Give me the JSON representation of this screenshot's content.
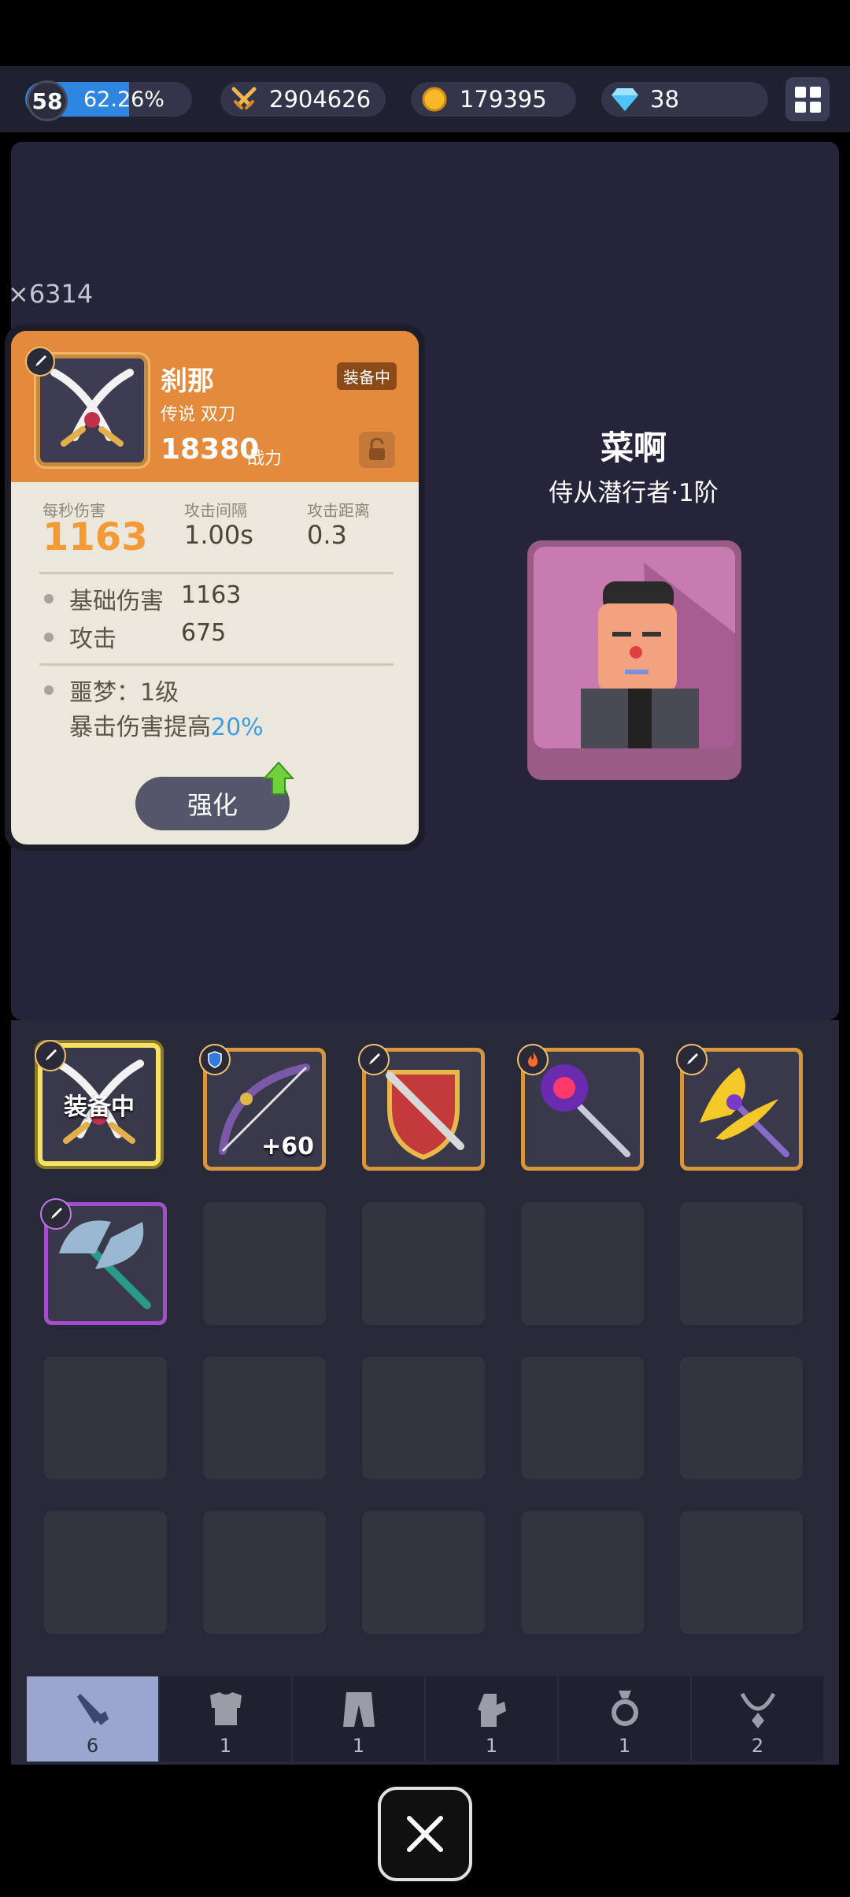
{
  "topbar": {
    "level": "58",
    "exp_percent": "62.26%",
    "exp_fraction": 0.6226,
    "power": "2904626",
    "gold": "179395",
    "gems": "38"
  },
  "count_label": "×6314",
  "weapon": {
    "name": "刹那",
    "rarity_type": "传说  双刀",
    "power": "18380",
    "power_label": "战力",
    "equip_tag": "装备中",
    "stats": {
      "dps_label": "每秒伤害",
      "dps_value": "1163",
      "interval_label": "攻击间隔",
      "interval_value": "1.00s",
      "range_label": "攻击距离",
      "range_value": "0.3"
    },
    "rows": [
      {
        "label": "基础伤害",
        "value": "1163"
      },
      {
        "label": "攻击",
        "value": "675"
      }
    ],
    "bonus_title": "噩梦：1级",
    "bonus_text": "暴击伤害提高",
    "bonus_value": "20%",
    "upgrade_label": "强化"
  },
  "character": {
    "name": "菜啊",
    "title": "侍从潜行者·1阶"
  },
  "inventory": {
    "equipped_label": "装备中",
    "bow_plus": "+60"
  },
  "tabs": [
    {
      "icon": "sword-icon",
      "count": "6"
    },
    {
      "icon": "armor-icon",
      "count": "1"
    },
    {
      "icon": "pants-icon",
      "count": "1"
    },
    {
      "icon": "glove-icon",
      "count": "1"
    },
    {
      "icon": "ring-icon",
      "count": "1"
    },
    {
      "icon": "necklace-icon",
      "count": "2"
    }
  ],
  "colors": {
    "accent_orange": "#e48a3c",
    "exp_blue": "#2f86e0",
    "highlight_blue": "#3a9ee6",
    "dps_orange": "#f29a35"
  }
}
